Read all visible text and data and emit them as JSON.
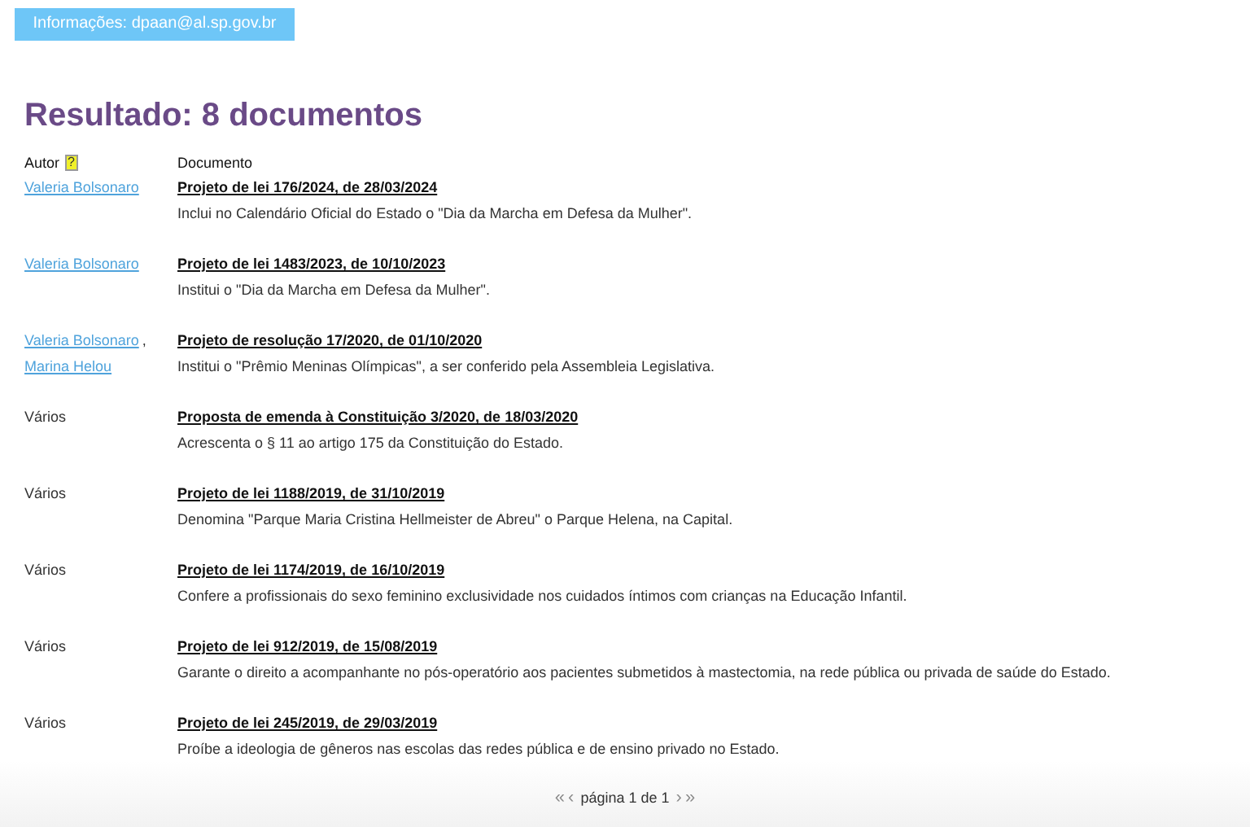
{
  "banner": {
    "text": "Informações: dpaan@al.sp.gov.br"
  },
  "title": "Resultado: 8 documentos",
  "columns": [
    {
      "label": "Autor",
      "help_icon": "?"
    },
    {
      "label": "Documento"
    }
  ],
  "rows": [
    {
      "authors": [
        {
          "kind": "link",
          "name": "Valeria Bolsonaro"
        }
      ],
      "document": "Projeto de lei 176/2024, de 28/03/2024",
      "summary": "Inclui no Calendário Oficial do Estado o \"Dia da Marcha em Defesa da Mulher\"."
    },
    {
      "authors": [
        {
          "kind": "link",
          "name": "Valeria Bolsonaro"
        }
      ],
      "document": "Projeto de lei 1483/2023, de 10/10/2023",
      "summary": "Institui o \"Dia da Marcha em Defesa da Mulher\"."
    },
    {
      "authors": [
        {
          "kind": "link",
          "name": "Valeria Bolsonaro",
          "separator": ","
        },
        {
          "kind": "link",
          "name": "Marina Helou"
        }
      ],
      "document": "Projeto de resolução 17/2020, de 01/10/2020",
      "summary": "Institui o \"Prêmio Meninas Olímpicas\", a ser conferido pela Assembleia Legislativa."
    },
    {
      "authors": [
        {
          "kind": "plain",
          "name": "Vários"
        }
      ],
      "document": "Proposta de emenda à Constituição 3/2020, de 18/03/2020",
      "summary": "Acrescenta o § 11 ao artigo 175 da Constituição do Estado."
    },
    {
      "authors": [
        {
          "kind": "plain",
          "name": "Vários"
        }
      ],
      "document": "Projeto de lei 1188/2019, de 31/10/2019",
      "summary": "Denomina \"Parque Maria Cristina Hellmeister de Abreu\" o Parque Helena, na Capital."
    },
    {
      "authors": [
        {
          "kind": "plain",
          "name": "Vários"
        }
      ],
      "document": "Projeto de lei 1174/2019, de 16/10/2019",
      "summary": "Confere a profissionais do sexo feminino exclusividade nos cuidados íntimos com crianças na Educação Infantil."
    },
    {
      "authors": [
        {
          "kind": "plain",
          "name": "Vários"
        }
      ],
      "document": "Projeto de lei 912/2019, de 15/08/2019",
      "summary": "Garante o direito a acompanhante no pós-operatório aos pacientes submetidos à mastectomia, na rede pública ou privada de saúde do Estado."
    },
    {
      "authors": [
        {
          "kind": "plain",
          "name": "Vários"
        }
      ],
      "document": "Projeto de lei 245/2019, de 29/03/2019",
      "summary": "Proíbe a ideologia de gêneros nas escolas das redes pública e de ensino privado no Estado."
    }
  ],
  "pagination": {
    "label": "página 1 de 1",
    "buttons_before": [
      {
        "text": "«",
        "disabled": true
      },
      {
        "text": "‹",
        "disabled": true
      }
    ],
    "buttons_after": [
      {
        "text": "›",
        "disabled": true
      },
      {
        "text": "»",
        "disabled": true
      }
    ]
  }
}
